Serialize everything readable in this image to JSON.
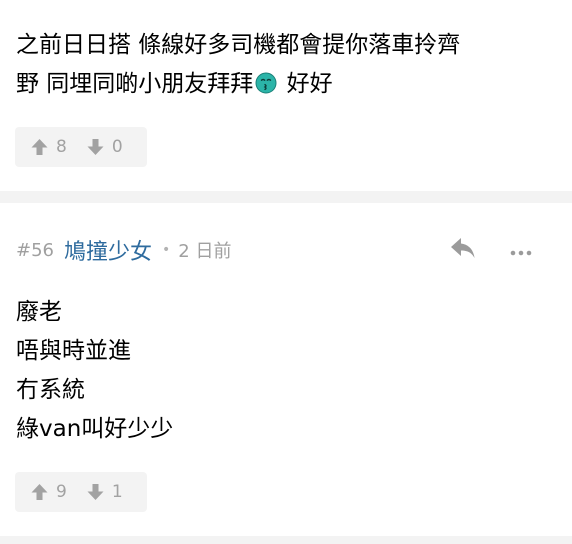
{
  "posts": [
    {
      "body_line1": "之前日日搭 條線好多司機都會提你落車拎齊",
      "body_line2_before_emoji": "野 同埋同啲小朋友拜拜",
      "body_line2_after_emoji": " 好好",
      "emoji_icon": "kissing-face-icon",
      "upvotes": "8",
      "downvotes": "0"
    },
    {
      "reply_number": "#56",
      "author": "鳩撞少女",
      "separator": "•",
      "time_ago": "2 日前",
      "body_lines": [
        "廢老",
        "唔與時並進",
        "冇系統",
        "綠van叫好少少"
      ],
      "upvotes": "9",
      "downvotes": "1"
    }
  ],
  "icons": {
    "upvote": "arrow-up-icon",
    "downvote": "arrow-down-icon",
    "reply": "reply-icon",
    "more": "more-dots-icon"
  },
  "colors": {
    "author": "#2e6b9e",
    "muted": "#a0a0a0",
    "vote_bg": "#f3f3f3",
    "divider": "#f3f3f3",
    "emoji": "#2bb4a8"
  }
}
